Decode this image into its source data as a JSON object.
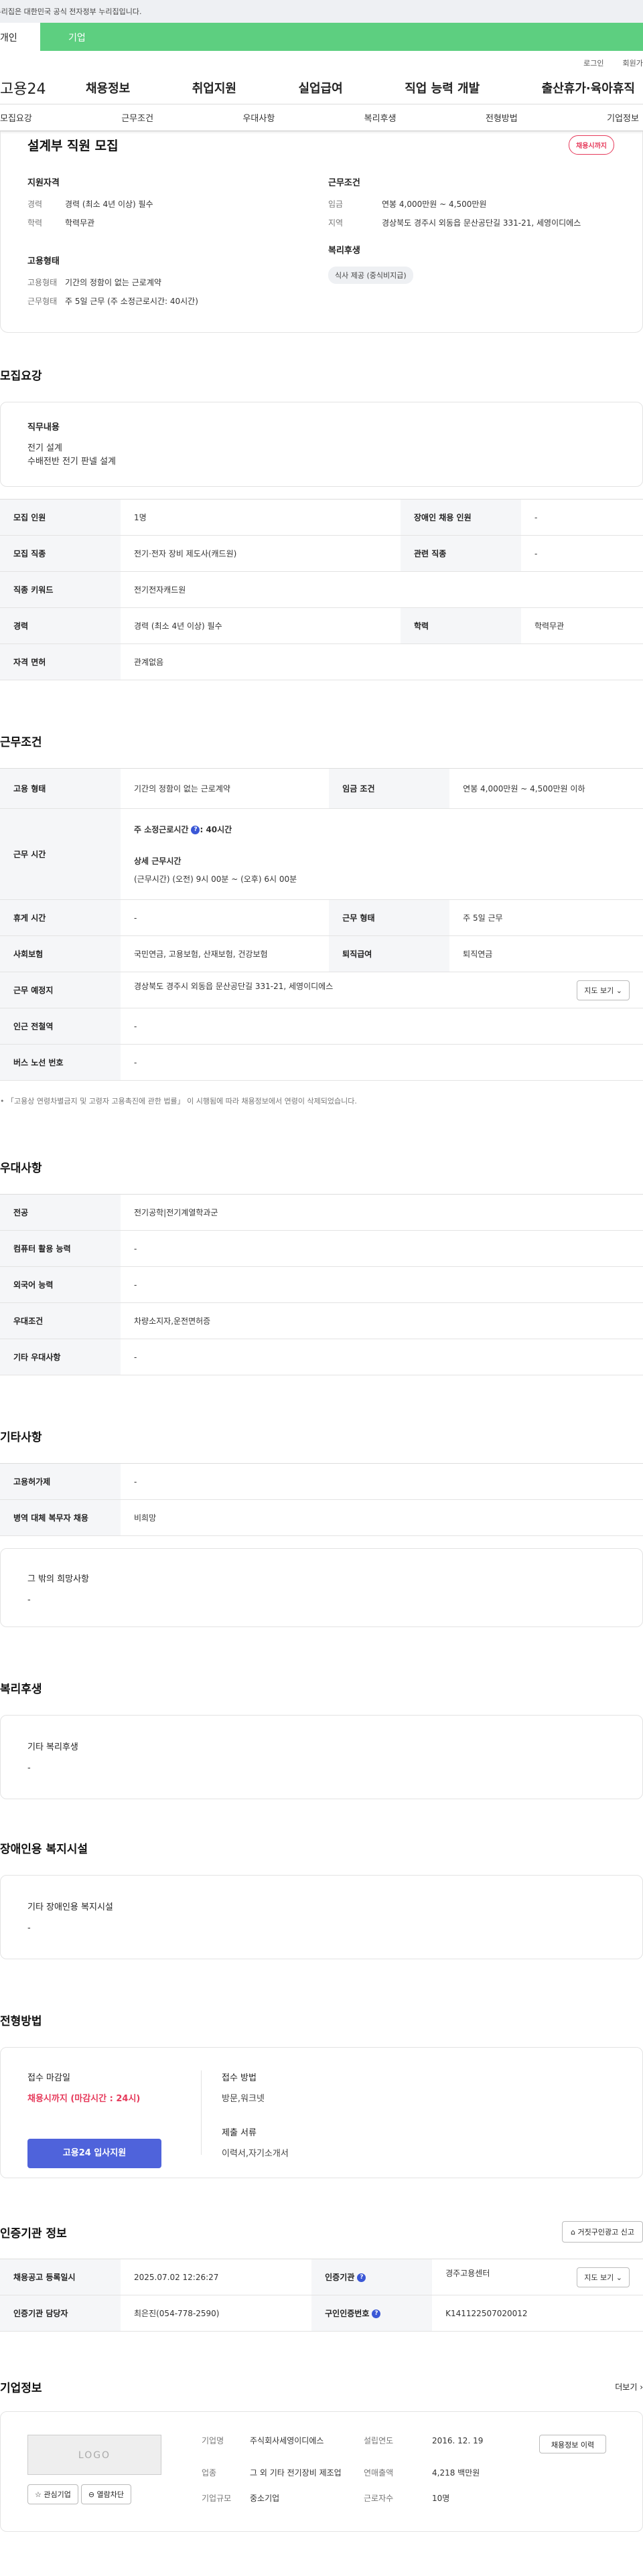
{
  "gov_notice": "이 누리집은 대한민국 공식 전자정부 누리집입니다.",
  "user_tabs": [
    "개인",
    "기업"
  ],
  "util": {
    "login": "로그인",
    "join": "회원가입"
  },
  "logo": "고용24",
  "gnb": [
    "채용정보",
    "취업지원",
    "실업급여",
    "직업 능력 개발",
    "출산휴가·육아휴직"
  ],
  "snb": [
    "모집요강",
    "근무조건",
    "우대사항",
    "복리후생",
    "전형방법",
    "기업정보"
  ],
  "job": {
    "title": "설계부 직원 모집",
    "badge": "채용시까지"
  },
  "summary": {
    "qual_title": "지원자격",
    "qual": [
      [
        "경력",
        "경력 (최소 4년 이상) 필수"
      ],
      [
        "학력",
        "학력무관"
      ]
    ],
    "emp_title": "고용형태",
    "emp": [
      [
        "고용형태",
        "기간의 정함이 없는 근로계약"
      ],
      [
        "근무형태",
        "주 5일 근무 (주 소정근로시간: 40시간)"
      ]
    ],
    "cond_title": "근무조건",
    "cond": [
      [
        "임금",
        "연봉 4,000만원 ~ 4,500만원"
      ],
      [
        "지역",
        "경상북도 경주시 외동읍 문산공단길 331-21, 세영이디에스"
      ]
    ],
    "welfare_title": "복리후생",
    "welfare_chip": "식사 제공 (중식비지급)"
  },
  "recruit": {
    "title": "모집요강",
    "duty_title": "직무내용",
    "duty_lines": [
      "전기 설계",
      "수배전반 전기 판넬 설계"
    ],
    "rows": [
      [
        "모집 인원",
        "1명",
        "장애인 채용 인원",
        "-"
      ],
      [
        "모집 직종",
        "전기·전자 장비 제도사(캐드원)",
        "관련 직종",
        "-"
      ],
      [
        "직종 키워드",
        "전기전자캐드원",
        "",
        ""
      ],
      [
        "경력",
        "경력 (최소 4년 이상) 필수",
        "학력",
        "학력무관"
      ],
      [
        "자격 면허",
        "관계없음",
        "",
        ""
      ]
    ]
  },
  "work": {
    "title": "근무조건",
    "emp_type_l": "고용 형태",
    "emp_type_v": "기간의 정함이 없는 근로계약",
    "wage_l": "임금 조건",
    "wage_v": "연봉 4,000만원 ~ 4,500만원 이하",
    "hours_l": "근무 시간",
    "hours_main": "주 소정근로시간",
    "hours_val": ": 40시간",
    "hours_q": "?",
    "hours_detail_l": "상세 근무시간",
    "hours_detail": "(근무시간) (오전) 9시 00분 ~ (오후) 6시 00분",
    "rest_l": "휴게 시간",
    "rest_v": "-",
    "form_l": "근무 형태",
    "form_v": "주 5일 근무",
    "ins_l": "사회보험",
    "ins_v": "국민연금, 고용보험, 산재보험, 건강보험",
    "ret_l": "퇴직급여",
    "ret_v": "퇴직연금",
    "place_l": "근무 예정지",
    "place_v": "경상북도 경주시 외동읍 문산공단길 331-21, 세영이디에스",
    "map_btn": "지도 보기 ⌄",
    "station_l": "인근 전철역",
    "station_v": "-",
    "bus_l": "버스 노선 번호",
    "bus_v": "-",
    "note": "「고용상 연령차별금지 및 고령자 고용촉진에 관한 법률」 이 시행됨에 따라 채용정보에서 연령이 삭제되었습니다."
  },
  "pref": {
    "title": "우대사항",
    "rows": [
      [
        "전공",
        "전기공학|전기계열학과군"
      ],
      [
        "컴퓨터 활용 능력",
        "-"
      ],
      [
        "외국어 능력",
        "-"
      ],
      [
        "우대조건",
        "차량소지자,운전면허증"
      ],
      [
        "기타 우대사항",
        "-"
      ]
    ]
  },
  "etc": {
    "title": "기타사항",
    "rows": [
      [
        "고용허가제",
        "-"
      ],
      [
        "병역 대체 복무자 채용",
        "비희망"
      ]
    ],
    "hope_title": "그 밖의 희망사항",
    "hope_v": "-"
  },
  "welfare": {
    "title": "복리후생",
    "sub": "기타 복리후생",
    "v": "-"
  },
  "disab": {
    "title": "장애인용 복지시설",
    "sub": "기타 장애인용 복지시설",
    "v": "-"
  },
  "select": {
    "title": "전형방법",
    "deadline_l": "접수 마감일",
    "deadline_v": "채용시까지 (마감시간 : 24시)",
    "apply_btn": "고용24 입사지원",
    "method_l": "접수 방법",
    "method_v": "방문,워크넷",
    "docs_l": "제출 서류",
    "docs_v": "이력서,자기소개서"
  },
  "cert": {
    "title": "인증기관 정보",
    "report_btn": "⌂ 거짓구인광고 신고",
    "rows": [
      [
        "채용공고 등록일시",
        "2025.07.02 12:26:27",
        "인증기관",
        "경주고용센터"
      ],
      [
        "인증기관 담당자",
        "최은진(054-778-2590)",
        "구인인증번호",
        "K141122507020012"
      ]
    ],
    "map_btn": "지도 보기 ⌄"
  },
  "company": {
    "title": "기업정보",
    "more": "더보기 ›",
    "logo": "LOGO",
    "fav_btn": "☆ 관심기업",
    "block_btn": "⊖ 열람차단",
    "info_btn": "채용정보 이력",
    "name_l": "기업명",
    "name_v": "주식회사세영이디에스",
    "ind_l": "업종",
    "ind_v": "그 외 기타 전기장비 제조업",
    "size_l": "기업규모",
    "size_v": "중소기업",
    "est_l": "설립연도",
    "est_v": "2016. 12. 19",
    "sales_l": "연매출액",
    "sales_v": "4,218 백만원",
    "emp_l": "근로자수",
    "emp_v": "10명"
  }
}
